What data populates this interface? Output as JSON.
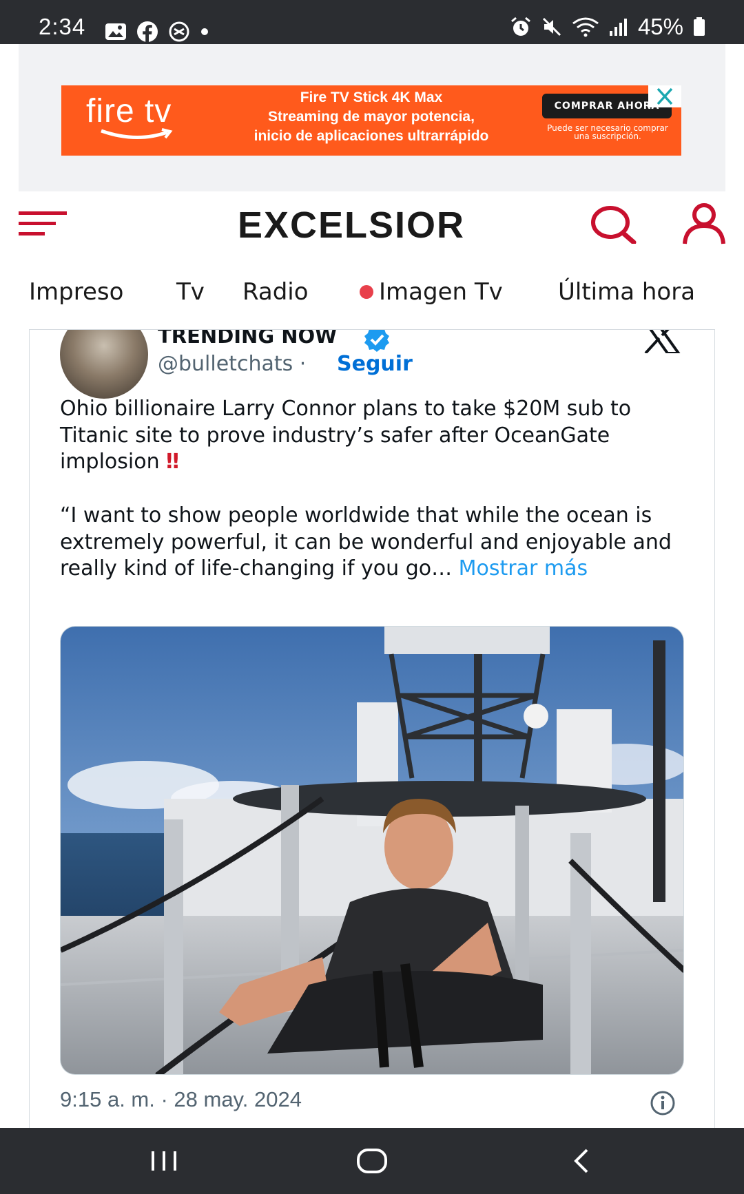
{
  "status_bar": {
    "time": "2:34",
    "battery": "45%"
  },
  "ad": {
    "brand": "fire tv",
    "line1": "Fire TV Stick 4K Max",
    "line2": "Streaming de mayor potencia,",
    "line3": "inicio de aplicaciones ultrarrápido",
    "cta": "COMPRAR AHORA",
    "fine_print": "Puede ser necesario comprar una suscripción.",
    "bg_color": "#ff5a1c"
  },
  "header": {
    "logo": "EXCELSIOR",
    "accent_color": "#c8102e"
  },
  "nav": {
    "items": [
      "Impreso",
      "Tv",
      "Radio",
      "Imagen Tv",
      "Última hora"
    ]
  },
  "tweet": {
    "name": "TRENDING NOW",
    "handle": "@bulletchats",
    "separator": "·",
    "follow": "Seguir",
    "text_para1": "Ohio billionaire Larry Connor plans to take $20M sub to Titanic site to prove industry’s safer after OceanGate implosion ",
    "emoji": "‼",
    "text_para2": "“I want to show people worldwide that while the ocean is extremely powerful, it can be wonderful and enjoyable and really kind of life-changing if you go… ",
    "more": "Mostrar más",
    "timestamp": "9:15 a. m. · 28 may. 2024"
  }
}
